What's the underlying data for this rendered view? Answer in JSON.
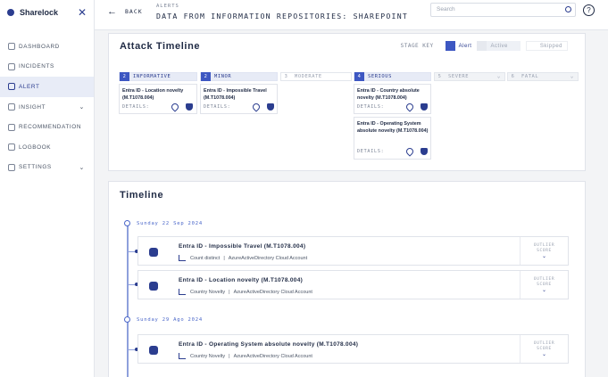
{
  "app": {
    "name": "Sharelock"
  },
  "sidebar": {
    "items": [
      {
        "label": "DASHBOARD"
      },
      {
        "label": "INCIDENTS"
      },
      {
        "label": "ALERT"
      },
      {
        "label": "INSIGHT"
      },
      {
        "label": "RECOMMENDATION"
      },
      {
        "label": "LOGBOOK"
      },
      {
        "label": "SETTINGS"
      }
    ]
  },
  "header": {
    "back_label": "BACK",
    "breadcrumb": "ALERTS",
    "title": "DATA FROM INFORMATION REPOSITORIES: SHAREPOINT",
    "search_placeholder": "Search",
    "help_label": "?"
  },
  "attack_timeline": {
    "title": "Attack Timeline",
    "stage_key": {
      "label": "STAGE KEY",
      "alert": "Alert",
      "active": "Active",
      "skipped": "Skipped"
    },
    "stages": [
      {
        "num": "2",
        "name": "INFORMATIVE"
      },
      {
        "num": "2",
        "name": "MINOR"
      },
      {
        "num": "3",
        "name": "MODERATE"
      },
      {
        "num": "4",
        "name": "SERIOUS"
      },
      {
        "num": "5",
        "name": "SEVERE"
      },
      {
        "num": "6",
        "name": "FATAL"
      }
    ],
    "alerts": [
      {
        "name": "Entra ID - Location novelty (M.T1078.004)",
        "details": "DETAILS:"
      },
      {
        "name": "Entra ID - Impossible Travel (M.T1078.004)",
        "details": "DETAILS:"
      },
      {
        "name": "Entra ID - Country absolute novelty (M.T1078.004)",
        "details": "DETAILS:"
      },
      {
        "name": "Entra ID - Operating System absolute novelty (M.T1078.004)",
        "details": "DETAILS:"
      }
    ]
  },
  "timeline": {
    "title": "Timeline",
    "dates": [
      "Sunday 22 Sep 2024",
      "Sunday 29 Ago 2024"
    ],
    "events": [
      {
        "title": "Entra ID - Impossible Travel (M.T1078.004)",
        "metric": "Count distinct",
        "source": "AzureActiveDirectory Cloud Account"
      },
      {
        "title": "Entra ID - Location novelty (M.T1078.004)",
        "metric": "Country Novelty",
        "source": "AzureActiveDirectory Cloud Account"
      },
      {
        "title": "Entra ID - Operating System absolute novelty (M.T1078.004)",
        "metric": "Country Novelty",
        "source": "AzureActiveDirectory Cloud Account"
      }
    ],
    "outlier_label_1": "OUTLIER",
    "outlier_label_2": "SCORE",
    "separator": "|"
  },
  "colors": {
    "primary": "#2b3d8f",
    "accent": "#3d57c2",
    "line": "#8ea0dc"
  }
}
